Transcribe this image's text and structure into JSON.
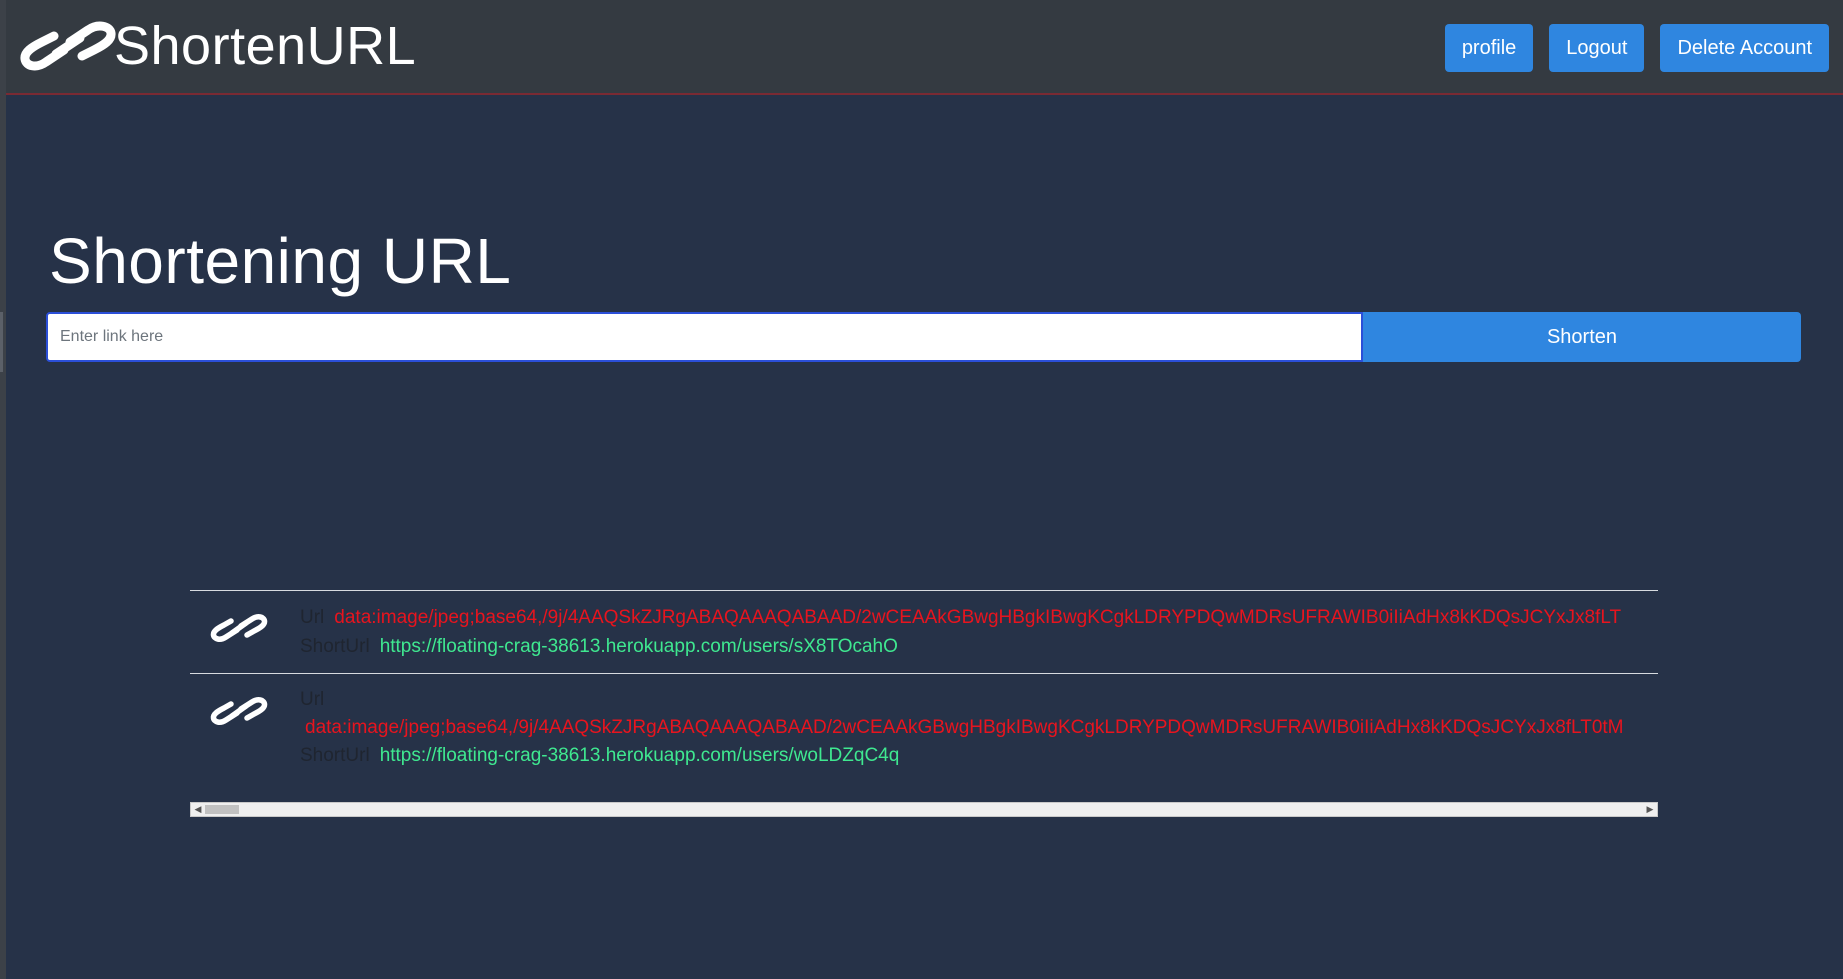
{
  "header": {
    "brand_icon": "link-icon",
    "brand_name": "ShortenURL",
    "buttons": {
      "profile": "profile",
      "logout": "Logout",
      "delete_account": "Delete Account"
    }
  },
  "main": {
    "title": "Shortening URL",
    "input_placeholder": "Enter link here",
    "input_value": "",
    "shorten_label": "Shorten"
  },
  "links": {
    "url_label": "Url",
    "short_label": "ShortUrl",
    "items": [
      {
        "url": "data:image/jpeg;base64,/9j/4AAQSkZJRgABAQAAAQABAAD/2wCEAAkGBwgHBgkIBwgKCgkLDRYPDQwMDRsUFRAWIB0iIiAdHx8kKDQsJCYxJx8fLT",
        "short_url": "https://floating-crag-38613.herokuapp.com/users/sX8TOcahO"
      },
      {
        "url": "data:image/jpeg;base64,/9j/4AAQSkZJRgABAQAAAQABAAD/2wCEAAkGBwgHBgkIBwgKCgkLDRYPDQwMDRsUFRAWIB0iIiAdHx8kKDQsJCYxJx8fLT0tM",
        "short_url": "https://floating-crag-38613.herokuapp.com/users/woLDZqC4q"
      }
    ]
  },
  "colors": {
    "background": "#263248",
    "navbar": "#343a41",
    "accent": "#2f86e0",
    "url_text": "#e8141e",
    "short_url_text": "#3fe890"
  }
}
